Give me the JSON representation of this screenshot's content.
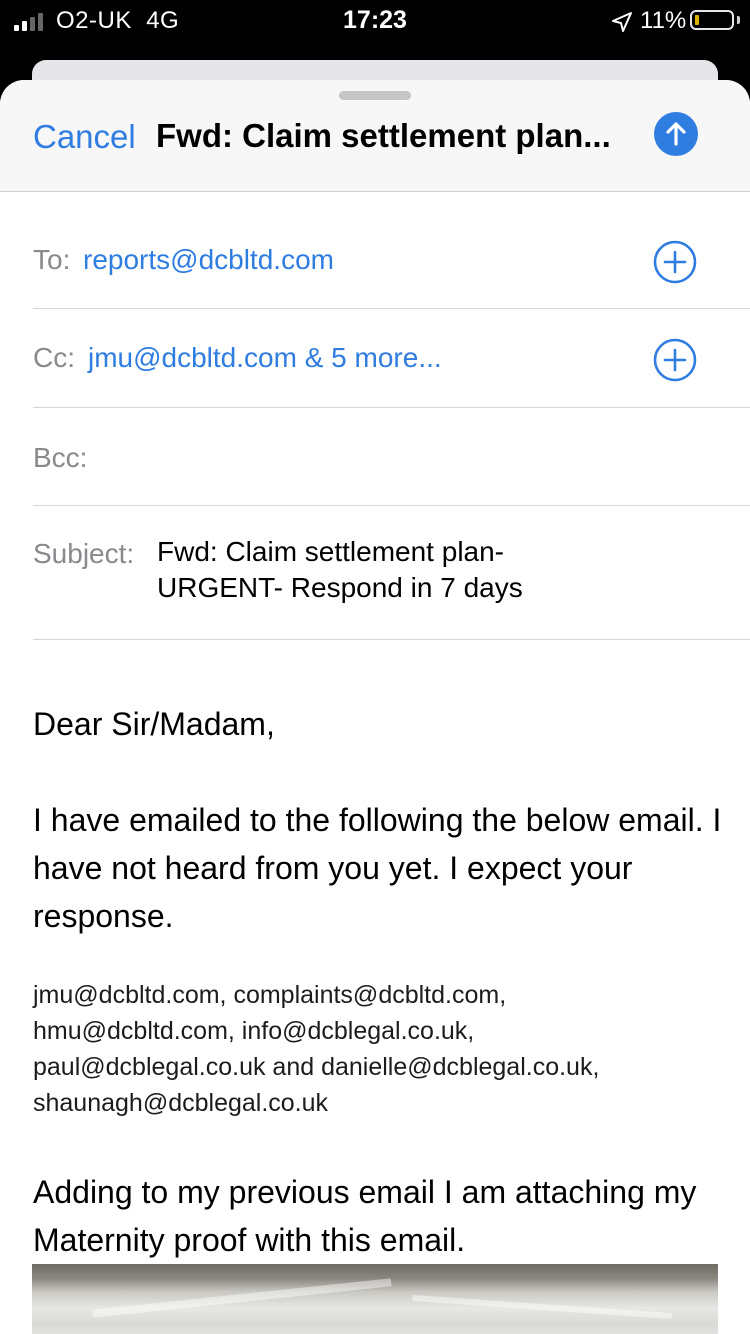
{
  "status_bar": {
    "carrier": "O2-UK",
    "network": "4G",
    "time": "17:23",
    "battery_percent": "11%",
    "battery_level": 0.11,
    "battery_color": "#f5c500",
    "signal_bars_active": 2,
    "signal_bars_total": 4
  },
  "compose": {
    "cancel_label": "Cancel",
    "title": "Fwd: Claim settlement plan...",
    "send_icon": "arrow-up-icon",
    "accent_color": "#2f7de1",
    "to": {
      "label": "To:",
      "value": "reports@dcbltd.com"
    },
    "cc": {
      "label": "Cc:",
      "value": "jmu@dcbltd.com & 5 more..."
    },
    "bcc": {
      "label": "Bcc:",
      "value": ""
    },
    "subject": {
      "label": "Subject:",
      "line1": "Fwd: Claim settlement plan-",
      "line2": "URGENT- Respond in 7 days"
    }
  },
  "body": {
    "greeting": "Dear Sir/Madam,",
    "paragraph1": "I have emailed to the following the below email. I have not heard from you yet. I expect your response.",
    "recipients": [
      "jmu@dcbltd.com, complaints@dcbltd.com,",
      "hmu@dcbltd.com, info@dcblegal.co.uk,",
      "paul@dcblegal.co.uk and danielle@dcblegal.co.uk,",
      "shaunagh@dcblegal.co.uk"
    ],
    "paragraph2": "Adding to my previous email I am attaching my Maternity proof with this email."
  }
}
